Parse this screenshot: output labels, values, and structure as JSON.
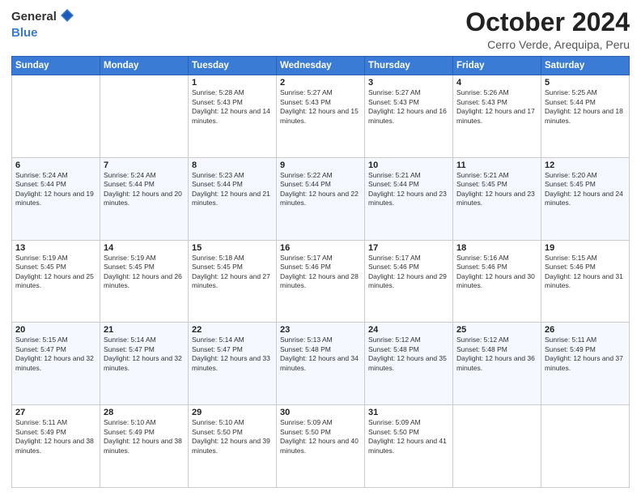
{
  "logo": {
    "line1": "General",
    "line2": "Blue"
  },
  "title": {
    "month_year": "October 2024",
    "location": "Cerro Verde, Arequipa, Peru"
  },
  "weekdays": [
    "Sunday",
    "Monday",
    "Tuesday",
    "Wednesday",
    "Thursday",
    "Friday",
    "Saturday"
  ],
  "weeks": [
    [
      {
        "day": "",
        "sunrise": "",
        "sunset": "",
        "daylight": ""
      },
      {
        "day": "",
        "sunrise": "",
        "sunset": "",
        "daylight": ""
      },
      {
        "day": "1",
        "sunrise": "Sunrise: 5:28 AM",
        "sunset": "Sunset: 5:43 PM",
        "daylight": "Daylight: 12 hours and 14 minutes."
      },
      {
        "day": "2",
        "sunrise": "Sunrise: 5:27 AM",
        "sunset": "Sunset: 5:43 PM",
        "daylight": "Daylight: 12 hours and 15 minutes."
      },
      {
        "day": "3",
        "sunrise": "Sunrise: 5:27 AM",
        "sunset": "Sunset: 5:43 PM",
        "daylight": "Daylight: 12 hours and 16 minutes."
      },
      {
        "day": "4",
        "sunrise": "Sunrise: 5:26 AM",
        "sunset": "Sunset: 5:43 PM",
        "daylight": "Daylight: 12 hours and 17 minutes."
      },
      {
        "day": "5",
        "sunrise": "Sunrise: 5:25 AM",
        "sunset": "Sunset: 5:44 PM",
        "daylight": "Daylight: 12 hours and 18 minutes."
      }
    ],
    [
      {
        "day": "6",
        "sunrise": "Sunrise: 5:24 AM",
        "sunset": "Sunset: 5:44 PM",
        "daylight": "Daylight: 12 hours and 19 minutes."
      },
      {
        "day": "7",
        "sunrise": "Sunrise: 5:24 AM",
        "sunset": "Sunset: 5:44 PM",
        "daylight": "Daylight: 12 hours and 20 minutes."
      },
      {
        "day": "8",
        "sunrise": "Sunrise: 5:23 AM",
        "sunset": "Sunset: 5:44 PM",
        "daylight": "Daylight: 12 hours and 21 minutes."
      },
      {
        "day": "9",
        "sunrise": "Sunrise: 5:22 AM",
        "sunset": "Sunset: 5:44 PM",
        "daylight": "Daylight: 12 hours and 22 minutes."
      },
      {
        "day": "10",
        "sunrise": "Sunrise: 5:21 AM",
        "sunset": "Sunset: 5:44 PM",
        "daylight": "Daylight: 12 hours and 23 minutes."
      },
      {
        "day": "11",
        "sunrise": "Sunrise: 5:21 AM",
        "sunset": "Sunset: 5:45 PM",
        "daylight": "Daylight: 12 hours and 23 minutes."
      },
      {
        "day": "12",
        "sunrise": "Sunrise: 5:20 AM",
        "sunset": "Sunset: 5:45 PM",
        "daylight": "Daylight: 12 hours and 24 minutes."
      }
    ],
    [
      {
        "day": "13",
        "sunrise": "Sunrise: 5:19 AM",
        "sunset": "Sunset: 5:45 PM",
        "daylight": "Daylight: 12 hours and 25 minutes."
      },
      {
        "day": "14",
        "sunrise": "Sunrise: 5:19 AM",
        "sunset": "Sunset: 5:45 PM",
        "daylight": "Daylight: 12 hours and 26 minutes."
      },
      {
        "day": "15",
        "sunrise": "Sunrise: 5:18 AM",
        "sunset": "Sunset: 5:45 PM",
        "daylight": "Daylight: 12 hours and 27 minutes."
      },
      {
        "day": "16",
        "sunrise": "Sunrise: 5:17 AM",
        "sunset": "Sunset: 5:46 PM",
        "daylight": "Daylight: 12 hours and 28 minutes."
      },
      {
        "day": "17",
        "sunrise": "Sunrise: 5:17 AM",
        "sunset": "Sunset: 5:46 PM",
        "daylight": "Daylight: 12 hours and 29 minutes."
      },
      {
        "day": "18",
        "sunrise": "Sunrise: 5:16 AM",
        "sunset": "Sunset: 5:46 PM",
        "daylight": "Daylight: 12 hours and 30 minutes."
      },
      {
        "day": "19",
        "sunrise": "Sunrise: 5:15 AM",
        "sunset": "Sunset: 5:46 PM",
        "daylight": "Daylight: 12 hours and 31 minutes."
      }
    ],
    [
      {
        "day": "20",
        "sunrise": "Sunrise: 5:15 AM",
        "sunset": "Sunset: 5:47 PM",
        "daylight": "Daylight: 12 hours and 32 minutes."
      },
      {
        "day": "21",
        "sunrise": "Sunrise: 5:14 AM",
        "sunset": "Sunset: 5:47 PM",
        "daylight": "Daylight: 12 hours and 32 minutes."
      },
      {
        "day": "22",
        "sunrise": "Sunrise: 5:14 AM",
        "sunset": "Sunset: 5:47 PM",
        "daylight": "Daylight: 12 hours and 33 minutes."
      },
      {
        "day": "23",
        "sunrise": "Sunrise: 5:13 AM",
        "sunset": "Sunset: 5:48 PM",
        "daylight": "Daylight: 12 hours and 34 minutes."
      },
      {
        "day": "24",
        "sunrise": "Sunrise: 5:12 AM",
        "sunset": "Sunset: 5:48 PM",
        "daylight": "Daylight: 12 hours and 35 minutes."
      },
      {
        "day": "25",
        "sunrise": "Sunrise: 5:12 AM",
        "sunset": "Sunset: 5:48 PM",
        "daylight": "Daylight: 12 hours and 36 minutes."
      },
      {
        "day": "26",
        "sunrise": "Sunrise: 5:11 AM",
        "sunset": "Sunset: 5:49 PM",
        "daylight": "Daylight: 12 hours and 37 minutes."
      }
    ],
    [
      {
        "day": "27",
        "sunrise": "Sunrise: 5:11 AM",
        "sunset": "Sunset: 5:49 PM",
        "daylight": "Daylight: 12 hours and 38 minutes."
      },
      {
        "day": "28",
        "sunrise": "Sunrise: 5:10 AM",
        "sunset": "Sunset: 5:49 PM",
        "daylight": "Daylight: 12 hours and 38 minutes."
      },
      {
        "day": "29",
        "sunrise": "Sunrise: 5:10 AM",
        "sunset": "Sunset: 5:50 PM",
        "daylight": "Daylight: 12 hours and 39 minutes."
      },
      {
        "day": "30",
        "sunrise": "Sunrise: 5:09 AM",
        "sunset": "Sunset: 5:50 PM",
        "daylight": "Daylight: 12 hours and 40 minutes."
      },
      {
        "day": "31",
        "sunrise": "Sunrise: 5:09 AM",
        "sunset": "Sunset: 5:50 PM",
        "daylight": "Daylight: 12 hours and 41 minutes."
      },
      {
        "day": "",
        "sunrise": "",
        "sunset": "",
        "daylight": ""
      },
      {
        "day": "",
        "sunrise": "",
        "sunset": "",
        "daylight": ""
      }
    ]
  ]
}
